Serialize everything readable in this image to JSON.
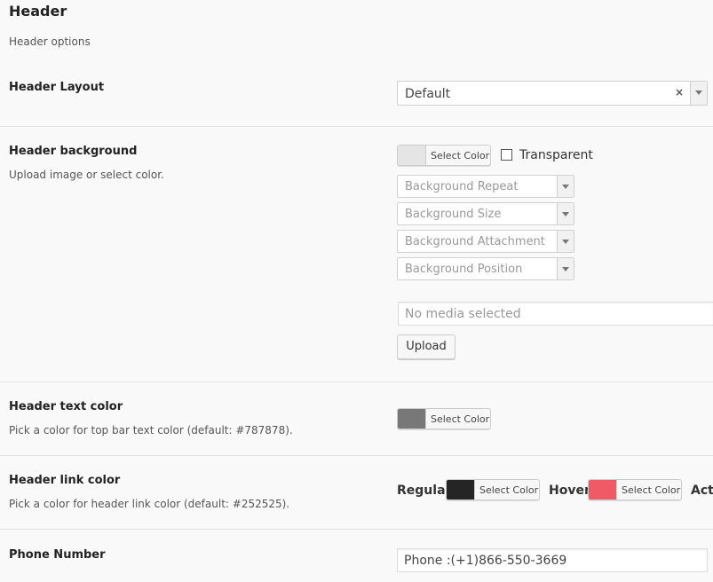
{
  "section": {
    "title": "Header",
    "description": "Header options"
  },
  "header_layout": {
    "label": "Header Layout",
    "selected": "Default",
    "clear_symbol": "×"
  },
  "header_background": {
    "label": "Header background",
    "description": "Upload image or select color.",
    "color_button_label": "Select Color",
    "swatch_color": "#e5e5e5",
    "transparent_label": "Transparent",
    "transparent_checked": false,
    "selects": [
      {
        "placeholder": "Background Repeat"
      },
      {
        "placeholder": "Background Size"
      },
      {
        "placeholder": "Background Attachment"
      },
      {
        "placeholder": "Background Position"
      }
    ],
    "media_placeholder": "No media selected",
    "upload_label": "Upload"
  },
  "header_text_color": {
    "label": "Header text color",
    "description": "Pick a color for top bar text color (default: #787878).",
    "color_button_label": "Select Color",
    "swatch_color": "#787878"
  },
  "header_link_color": {
    "label": "Header link color",
    "description": "Pick a color for header link color (default: #252525).",
    "regular_label": "Regular",
    "regular_color_button_label": "Select Color",
    "regular_swatch_color": "#252525",
    "hover_label": "Hover",
    "hover_color_button_label": "Select Color",
    "hover_swatch_color": "#f05a67",
    "active_label": "Acti"
  },
  "phone_number": {
    "label": "Phone Number",
    "value": "Phone :(+1)866-550-3669"
  }
}
